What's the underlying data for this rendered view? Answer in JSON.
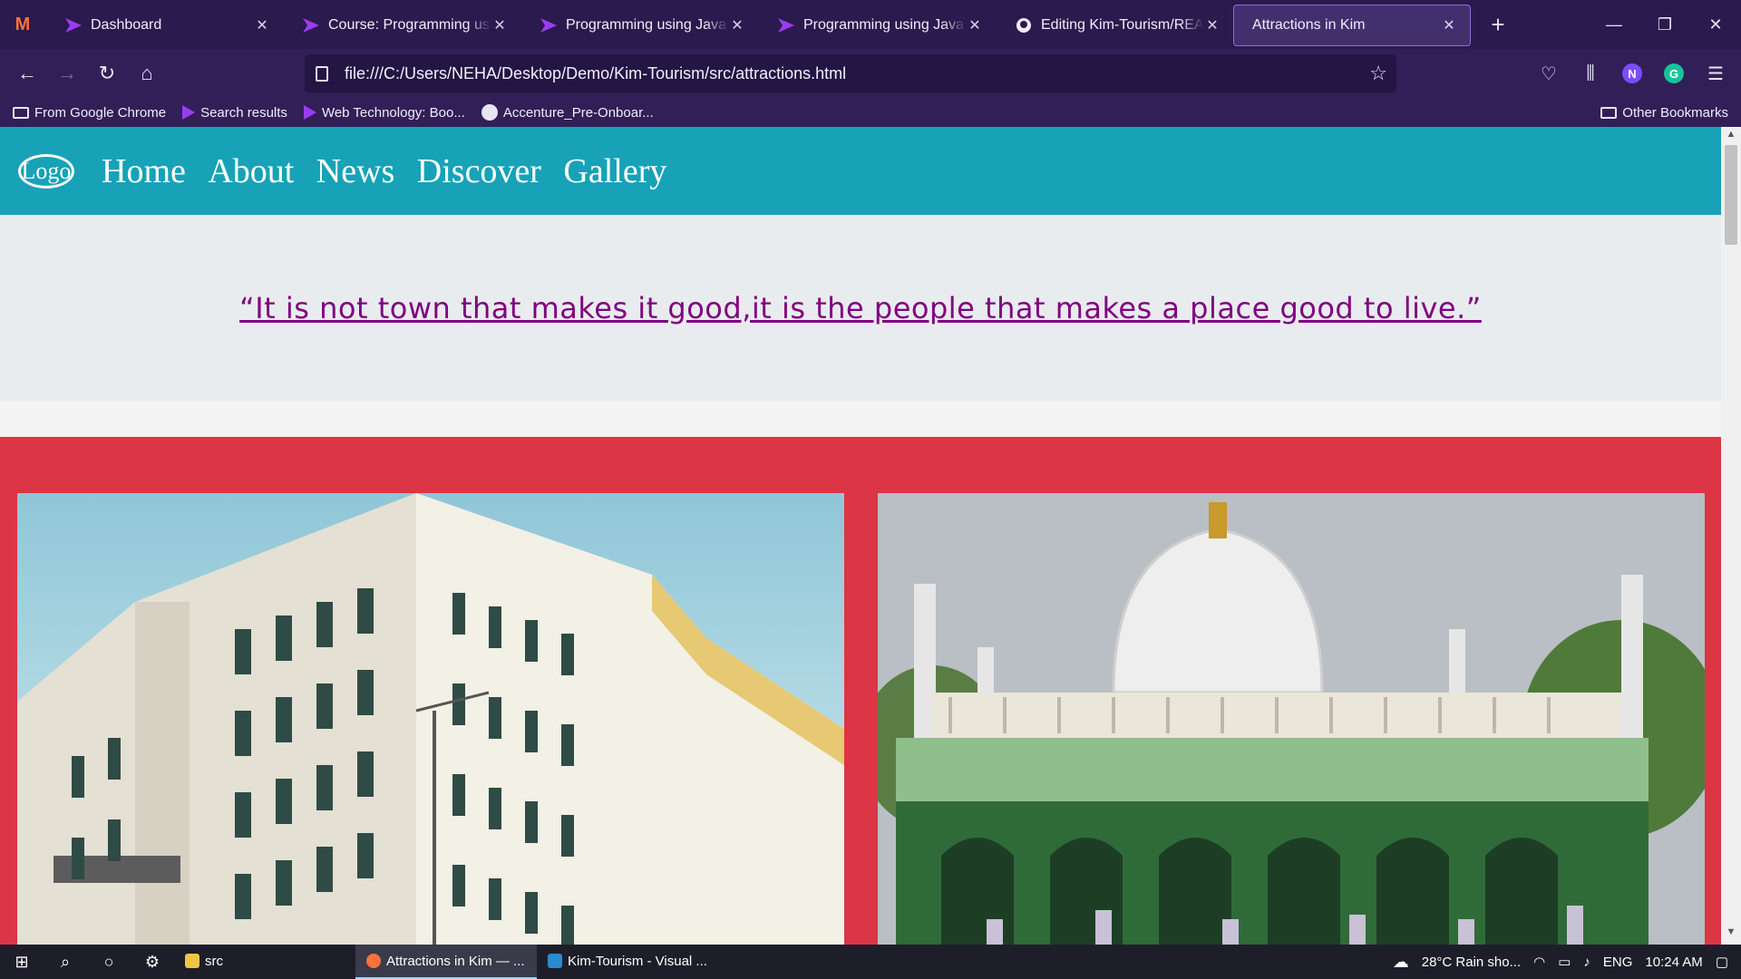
{
  "browser": {
    "tabs": [
      {
        "label": "Dashboard",
        "icon": "arrow-icon",
        "active": false
      },
      {
        "label": "Course: Programming using J",
        "icon": "arrow-icon",
        "active": false
      },
      {
        "label": "Programming using Java Cor",
        "icon": "arrow-icon",
        "active": false
      },
      {
        "label": "Programming using Java Mo",
        "icon": "arrow-icon",
        "active": false
      },
      {
        "label": "Editing Kim-Tourism/READM",
        "icon": "github-icon",
        "active": false
      },
      {
        "label": "Attractions in Kim",
        "icon": "",
        "active": true
      }
    ],
    "url": "file:///C:/Users/NEHA/Desktop/Demo/Kim-Tourism/src/attractions.html",
    "profile_initial": "N",
    "grammarly_initial": "G",
    "bookmarks": [
      {
        "label": "From Google Chrome",
        "icon": "folder-icon"
      },
      {
        "label": "Search results",
        "icon": "arrow-icon"
      },
      {
        "label": "Web Technology: Boo...",
        "icon": "arrow-icon"
      },
      {
        "label": "Accenture_Pre-Onboar...",
        "icon": "github-icon"
      }
    ],
    "other_bookmarks": "Other Bookmarks"
  },
  "site": {
    "logo": "Logo",
    "nav": [
      "Home",
      "About",
      "News",
      "Discover",
      "Gallery"
    ],
    "quote": "“It is not town that makes it good,it is the people that makes a place good to live.”",
    "colors": {
      "header": "#17a2b8",
      "quote_bg": "#e9ecef",
      "quote_text": "#800080",
      "section": "#dc3545"
    }
  },
  "taskbar": {
    "apps": [
      {
        "label": "src",
        "icon": "folder-icon",
        "active": false
      },
      {
        "label": "Attractions in Kim — ...",
        "icon": "firefox-icon",
        "active": true
      },
      {
        "label": "Kim-Tourism - Visual ...",
        "icon": "vscode-icon",
        "active": false
      }
    ],
    "weather": "28°C  Rain sho...",
    "language": "ENG",
    "time": "10:24 AM"
  }
}
